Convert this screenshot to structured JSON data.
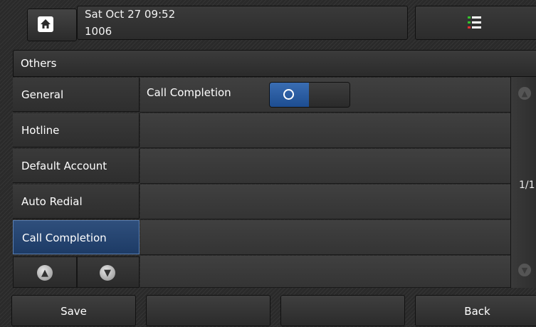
{
  "header": {
    "datetime": "Sat Oct 27 09:52",
    "extension": "1006",
    "home_icon": "home-icon",
    "menu_icon": "list-icon"
  },
  "section": {
    "title": "Others"
  },
  "nav": {
    "items": [
      {
        "label": "General"
      },
      {
        "label": "Hotline"
      },
      {
        "label": "Default Account"
      },
      {
        "label": "Auto Redial"
      },
      {
        "label": "Call Completion"
      }
    ],
    "active_index": 4
  },
  "content": {
    "rows": [
      {
        "label": "Call Completion",
        "value": "On"
      }
    ]
  },
  "scroll": {
    "page": "1/1"
  },
  "softkeys": {
    "save": "Save",
    "k2": "",
    "k3": "",
    "back": "Back"
  },
  "colors": {
    "accent": "#2f5aa0",
    "menu_green": "#35c22d",
    "menu_red": "#d33"
  }
}
